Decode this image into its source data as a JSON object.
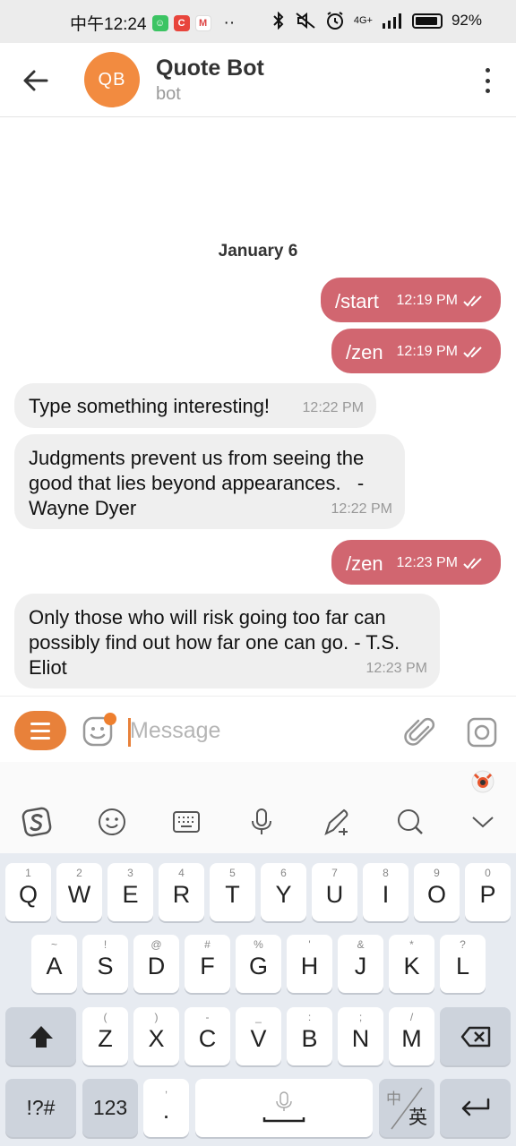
{
  "status_bar": {
    "time": "中午12:24",
    "more": "··",
    "network": "4G+",
    "battery": "92%"
  },
  "header": {
    "avatar_initials": "QB",
    "title": "Quote Bot",
    "subtitle": "bot"
  },
  "chat": {
    "date": "January 6",
    "messages": [
      {
        "text": "/start",
        "time": "12:19 PM"
      },
      {
        "text": "/zen",
        "time": "12:19 PM"
      },
      {
        "text": "Type something interesting!",
        "time": "12:22 PM"
      },
      {
        "line1": "Judgments prevent us from seeing the",
        "line2": "good that lies beyond appearances.   -",
        "line3": "Wayne Dyer",
        "time": "12:22 PM"
      },
      {
        "text": "/zen",
        "time": "12:23 PM"
      },
      {
        "line1": "Only those who will risk going too far can",
        "line2": "possibly find out how far one can go. - T.S.",
        "line3": "Eliot",
        "time": "12:23 PM"
      }
    ]
  },
  "composer": {
    "placeholder": "Message"
  },
  "keyboard": {
    "row1": [
      {
        "hint": "1",
        "key": "Q"
      },
      {
        "hint": "2",
        "key": "W"
      },
      {
        "hint": "3",
        "key": "E"
      },
      {
        "hint": "4",
        "key": "R"
      },
      {
        "hint": "5",
        "key": "T"
      },
      {
        "hint": "6",
        "key": "Y"
      },
      {
        "hint": "7",
        "key": "U"
      },
      {
        "hint": "8",
        "key": "I"
      },
      {
        "hint": "9",
        "key": "O"
      },
      {
        "hint": "0",
        "key": "P"
      }
    ],
    "row2": [
      {
        "hint": "~",
        "key": "A"
      },
      {
        "hint": "!",
        "key": "S"
      },
      {
        "hint": "@",
        "key": "D"
      },
      {
        "hint": "#",
        "key": "F"
      },
      {
        "hint": "%",
        "key": "G"
      },
      {
        "hint": "'",
        "key": "H"
      },
      {
        "hint": "&",
        "key": "J"
      },
      {
        "hint": "*",
        "key": "K"
      },
      {
        "hint": "?",
        "key": "L"
      }
    ],
    "row3": [
      {
        "hint": "(",
        "key": "Z"
      },
      {
        "hint": ")",
        "key": "X"
      },
      {
        "hint": "-",
        "key": "C"
      },
      {
        "hint": "_",
        "key": "V"
      },
      {
        "hint": ":",
        "key": "B"
      },
      {
        "hint": ";",
        "key": "N"
      },
      {
        "hint": "/",
        "key": "M"
      }
    ],
    "symbols_label": "!?#",
    "numbers_label": "123",
    "comma_hint": ",",
    "period_label": ".",
    "lang_top": "中",
    "lang_bottom": "英"
  }
}
